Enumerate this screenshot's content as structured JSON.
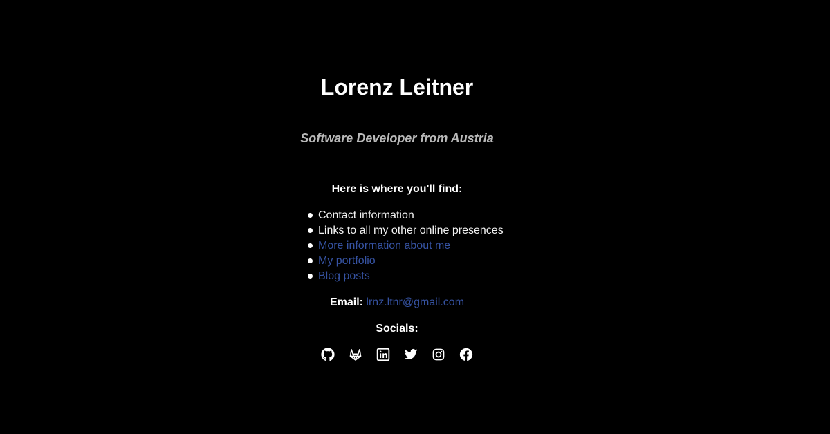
{
  "header": {
    "name": "Lorenz Leitner",
    "tagline": "Software Developer from Austria"
  },
  "find": {
    "heading": "Here is where you'll find:",
    "items": [
      {
        "label": "Contact information",
        "link": false
      },
      {
        "label": "Links to all my other online presences",
        "link": false
      },
      {
        "label": "More information about me",
        "link": true
      },
      {
        "label": "My portfolio",
        "link": true
      },
      {
        "label": "Blog posts",
        "link": true
      }
    ]
  },
  "contact": {
    "email_label": "Email:",
    "email": "lrnz.ltnr@gmail.com"
  },
  "socials": {
    "heading": "Socials:",
    "icons": [
      "github-icon",
      "gitlab-icon",
      "linkedin-icon",
      "twitter-icon",
      "instagram-icon",
      "facebook-icon"
    ]
  },
  "colors": {
    "background": "#000000",
    "text": "#f2f2f2",
    "subtitle": "#b9b9b9",
    "link": "#3653a3"
  }
}
